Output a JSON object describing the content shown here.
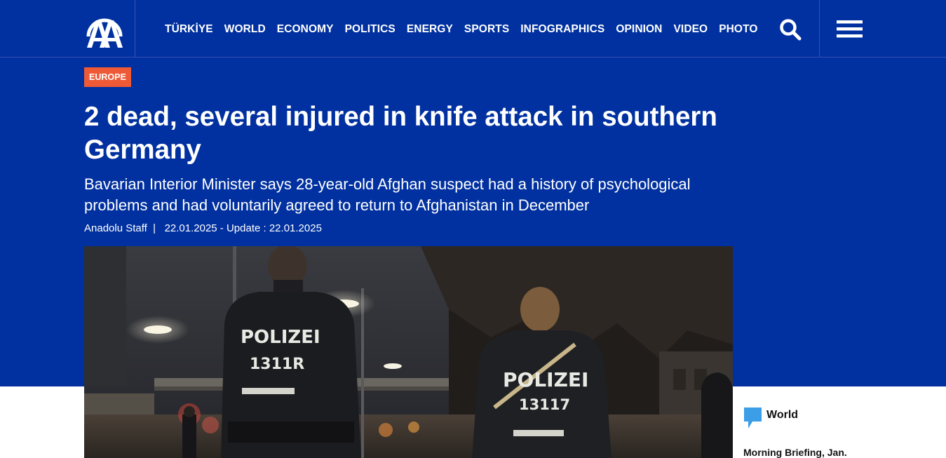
{
  "brand": {
    "logo_text": "AA"
  },
  "nav": {
    "items": [
      "TÜRKİYE",
      "WORLD",
      "ECONOMY",
      "POLITICS",
      "ENERGY",
      "SPORTS",
      "INFOGRAPHICS",
      "OPINION",
      "VIDEO",
      "PHOTO"
    ]
  },
  "header_icons": {
    "search": "search-icon",
    "menu": "hamburger-menu-icon"
  },
  "article": {
    "category": "EUROPE",
    "title": "2 dead, several injured in knife attack in southern Germany",
    "subtitle": "Bavarian Interior Minister says 28-year-old Afghan suspect had a history of psychological problems and had voluntarily agreed to return to Afghanistan in December",
    "author": "Anadolu Staff",
    "separator": "|",
    "date_line": "22.01.2025 - Update : 22.01.2025",
    "photo": {
      "officer_left_jacket": "POLIZEI",
      "officer_left_number": "1311R",
      "officer_right_jacket": "POLIZEI",
      "officer_right_number": "13117"
    }
  },
  "sidebar": {
    "category": "World",
    "headline": "Morning Briefing, Jan."
  },
  "colors": {
    "header_blue": "#0131a0",
    "category_orange": "#ef5a36",
    "sidebar_icon_blue": "#3b9ee6"
  }
}
